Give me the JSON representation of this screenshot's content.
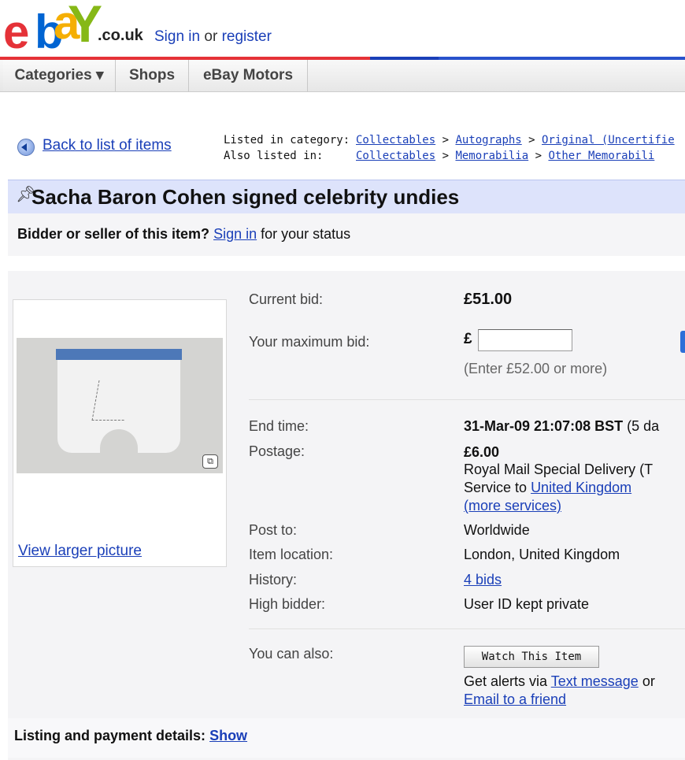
{
  "header": {
    "logo_text": "ebay",
    "tld": ".co.uk",
    "sign_in": "Sign in",
    "or": " or ",
    "register": "register"
  },
  "nav": {
    "tabs": [
      "Categories ▾",
      "Shops",
      "eBay Motors"
    ]
  },
  "back_link": "Back to list of items",
  "categories": {
    "listed_label": "Listed in category:",
    "listed_path": [
      "Collectables",
      "Autographs",
      "Original (Uncertifie"
    ],
    "also_label": "Also listed in:",
    "also_path": [
      "Collectables",
      "Memorabilia",
      "Other Memorabili"
    ],
    "sep": " > "
  },
  "item": {
    "title": "Sacha Baron Cohen signed celebrity undies",
    "status_prefix": "Bidder or seller of this item?",
    "status_link": "Sign in",
    "status_suffix": "for your status",
    "view_larger": "View larger picture",
    "current_bid_label": "Current bid:",
    "current_bid": "£51.00",
    "max_bid_label": "Your maximum bid:",
    "currency": "£",
    "bid_hint": "(Enter £52.00 or more)",
    "end_time_label": "End time:",
    "end_time": "31-Mar-09 21:07:08 BST",
    "end_time_suffix": "(5 da",
    "postage_label": "Postage:",
    "postage_price": "£6.00",
    "postage_service": "Royal Mail Special Delivery (T",
    "service_to": "Service to",
    "service_country": "United Kingdom",
    "more_services": "(more services)",
    "post_to_label": "Post to:",
    "post_to": "Worldwide",
    "location_label": "Item location:",
    "location": "London, United Kingdom",
    "history_label": "History:",
    "history": "4 bids",
    "high_bidder_label": "High bidder:",
    "high_bidder": "User ID kept private",
    "also_label": "You can also:",
    "watch_button": "Watch This Item",
    "alerts_prefix": "Get alerts via",
    "alerts_link": "Text message",
    "alerts_suffix": "or",
    "email_friend": "Email to a friend"
  },
  "listing": {
    "label": "Listing and payment details:",
    "show": "Show"
  }
}
